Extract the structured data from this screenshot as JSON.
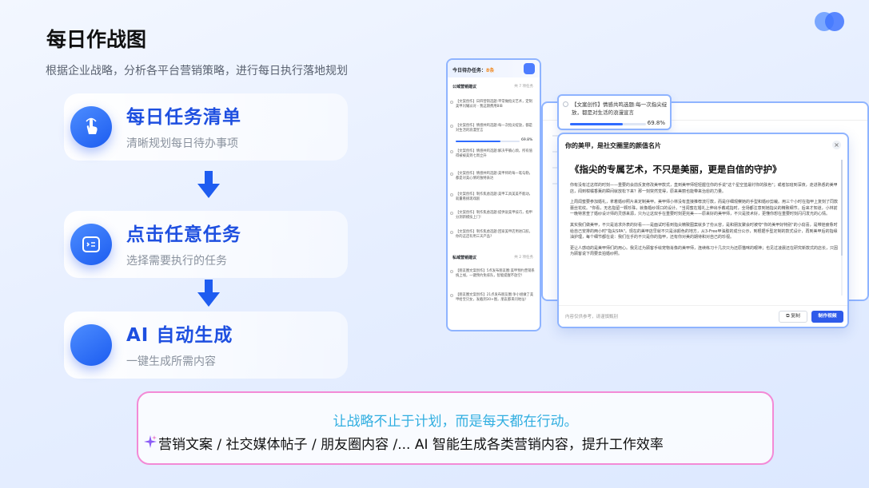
{
  "header": {
    "title": "每日作战图",
    "subtitle": "根据企业战略，分析各平台营销策略，进行每日执行落地规划"
  },
  "steps": [
    {
      "title": "每日任务清单",
      "desc": "清晰规划每日待办事项"
    },
    {
      "title": "点击任意任务",
      "desc": "选择需要执行的任务"
    },
    {
      "title": "AI 自动生成",
      "desc": "一键生成所需内容"
    }
  ],
  "left_panel": {
    "title_prefix": "今日待办任务：",
    "title_count": "8条",
    "section1": {
      "label": "公域营销建议",
      "meta": "共 7 项任务"
    },
    "section2": {
      "label": "私域营销建议",
      "meta": "共 2 项任务"
    },
    "items": [
      "【文案创作】日四营销选题:平常做指尖艺术，定制美甲闪耀派对 - 我这期费用BIB",
      "【文案创作】情感共鸣选题:每一次指尖绽放，都是对生活的浪漫宣言",
      "【文案创作】情感共鸣选题:解决平躺心烦，所有值得被被美到七周立升",
      "【文案创作】情感共鸣选题:美甲师的每一笔勾勒，都是对美心情的独特表达",
      "【文案创作】制作焦虑选题:美甲工具美美不能动，就量看挑现戏剧",
      "【文案创作】制作焦虑选题:提供说美甲技巧，指甲分测新模技上门!",
      "【文案创作】制作焦虑选题:回家美甲店用进口胶，你的这还有用三天产品?",
      "【朋友圈文案创作】5点发布朋友圈:美甲预约营销系统上线，一键预约免排队，智能提醒不放空!",
      "【朋友圈文案创作】21点发布朋友圈:争小姐做了美甲给宝贝女，发截到30+图，朋友都来问地址!"
    ],
    "progress_label": "69.8%"
  },
  "task_popup": {
    "text": "【文案创作】情感共鸣选题:每一次指尖绽放，都是对生活的浪漫宣言",
    "progress": 0.698,
    "progress_label": "69.8%"
  },
  "article_panel": {
    "title": "你的美甲，是社交圈里的颜值名片",
    "heading": "《指尖的专属艺术，不只是美丽，更是自信的守护》",
    "paragraphs": [
      "你有没有过这样的时刻——重要的会前反复修改美甲款式，直到美甲师轻轻握住你的手说\"这个星空蓝最衬你的肤色\"；或者加班到深夜，走进熟悉的美甲店，闻到柑橘香薰的瞬间就放松下来？那一刻突然觉得，原来美丽也能带来治愈的力量。",
      "上周闺蜜要参加婚礼，拿着婚纱照片来定制美甲。美甲师小林没有直接推荐流行款，而是仔细观察她的手型和婚纱剪裁。用三个小时在指甲上复刻了同款蕾丝花纹。\"你看，无名指留一颗珍珠，就像婚纱领口的设计。\"当闺蜜在婚礼上伸出手戴戒指时，全场都注意到她指尖的精致细节。后来才知道，小林前一晚特意查了婚纱设计师的灵感来源，只为让这双手在重要时刻更完美——原来好的美甲师，不只是技术好，更懂你想在重要时刻闪闪发光的心情。",
      "其实我们做美甲，不只是追求外表的好看——是面试时看到指尖精致图案就多了份从容，是和朋友聚会时被夸\"你的美甲好特别\"的小窃喜，是带娃疲惫时给自己安排的两小时\"指尖SPA\"。现在的美甲店早就不只是涂颜色的地方，从3-Free甲油胶的成分公示，到根据手型定制的款式设计，再到美甲后的指缘油护理，每个细节都在说：我们在乎的不只是你的指甲，还有你对美的期待和对自己的珍视。",
      "更让人感动的是美甲师们的用心。我见过为顾客手绘宠物肖像的美甲师，连续练习十几次只为还原猫咪的眼神；也见过凌晨还在研究新款式的店长，只因为顾客说下周要去拍婚纱照。"
    ],
    "footer_note": "内容仅供参考，请谨慎甄别",
    "copy_label": "复制",
    "video_label": "制作视频"
  },
  "bottom": {
    "line1": "让战略不止于计划，而是每天都在行动。",
    "line2": "营销文案 / 社交媒体帖子 / 朋友圈内容 /... AI 智能生成各类营销内容，提升工作效率"
  },
  "colors": {
    "accent": "#1e4fe0",
    "cyan": "#30aee0",
    "pink": "#f38ad6"
  }
}
